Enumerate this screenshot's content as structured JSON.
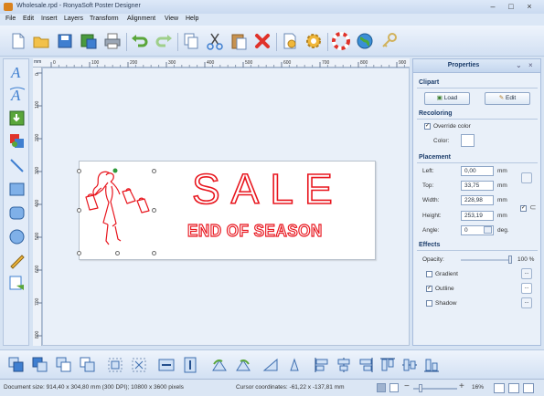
{
  "window": {
    "title": "Wholesale.rpd - RonyaSoft Poster Designer"
  },
  "menu": [
    "File",
    "Edit",
    "Insert",
    "Layers",
    "Transform",
    "Alignment",
    "View",
    "Help"
  ],
  "toolbar": {
    "icons": [
      "new-icon",
      "open-icon",
      "save-icon",
      "save-as-icon",
      "print-icon",
      "undo-icon",
      "redo-icon",
      "copy-icon",
      "cut-icon",
      "paste-icon",
      "delete-icon",
      "page-setup-icon",
      "settings-icon",
      "help-icon",
      "web-icon",
      "key-icon"
    ]
  },
  "left_tools": [
    "text-icon",
    "curved-text-icon",
    "image-icon",
    "clipart-icon",
    "line-icon",
    "rectangle-icon",
    "rounded-rect-icon",
    "ellipse-icon",
    "pencil-icon",
    "export-icon"
  ],
  "ruler": {
    "unit": "mm",
    "top_ticks": [
      "0",
      "100",
      "200",
      "300",
      "400",
      "500",
      "600",
      "700",
      "800",
      "900"
    ],
    "left_ticks": [
      "0",
      "100",
      "200",
      "300",
      "400",
      "500",
      "600",
      "700",
      "800"
    ]
  },
  "poster": {
    "line1": "SALE",
    "line2": "END OF SEASON",
    "accent": "#e8161e"
  },
  "properties": {
    "title": "Properties",
    "clipart": {
      "header": "Clipart",
      "load_label": "Load",
      "edit_label": "Edit"
    },
    "recoloring": {
      "header": "Recoloring",
      "override_label": "Override color",
      "override_checked": true,
      "color_label": "Color:",
      "color": "#ffffff"
    },
    "placement": {
      "header": "Placement",
      "left_label": "Left:",
      "left_value": "0,00",
      "top_label": "Top:",
      "top_value": "33,75",
      "width_label": "Width:",
      "width_value": "228,98",
      "height_label": "Height:",
      "height_value": "253,19",
      "angle_label": "Angle:",
      "angle_value": "0",
      "unit": "mm",
      "angle_unit": "deg."
    },
    "effects": {
      "header": "Effects",
      "opacity_label": "Opacity:",
      "opacity_value": "100 %",
      "opacity": 1.0,
      "gradient_label": "Gradient",
      "gradient_checked": false,
      "outline_label": "Outline",
      "outline_checked": true,
      "shadow_label": "Shadow",
      "shadow_checked": false
    }
  },
  "status": {
    "doc_size": "Document size: 914,40 x 304,80 mm (300 DPI); 10800 x 3600 pixels",
    "cursor": "Cursor coordinates: -61,22 x -137,81 mm",
    "zoom": "16%"
  }
}
